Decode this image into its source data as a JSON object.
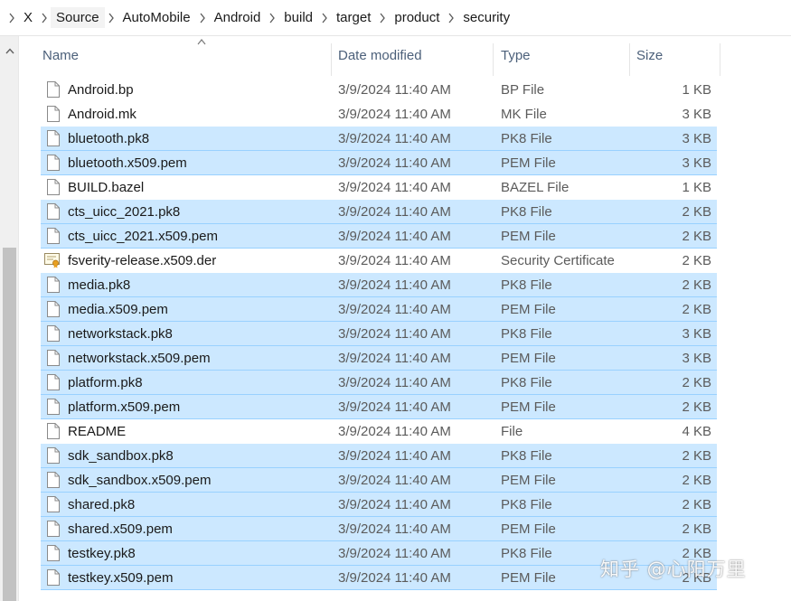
{
  "breadcrumb": {
    "root": "X",
    "items": [
      "Source",
      "AutoMobile",
      "Android",
      "build",
      "target",
      "product",
      "security"
    ]
  },
  "columns": {
    "name": "Name",
    "date": "Date modified",
    "type": "Type",
    "size": "Size"
  },
  "files": [
    {
      "name": "Android.bp",
      "date": "3/9/2024 11:40 AM",
      "type": "BP File",
      "size": "1 KB",
      "selected": false,
      "icon": "file-icon"
    },
    {
      "name": "Android.mk",
      "date": "3/9/2024 11:40 AM",
      "type": "MK File",
      "size": "3 KB",
      "selected": false,
      "icon": "file-icon"
    },
    {
      "name": "bluetooth.pk8",
      "date": "3/9/2024 11:40 AM",
      "type": "PK8 File",
      "size": "3 KB",
      "selected": true,
      "icon": "file-icon"
    },
    {
      "name": "bluetooth.x509.pem",
      "date": "3/9/2024 11:40 AM",
      "type": "PEM File",
      "size": "3 KB",
      "selected": true,
      "icon": "file-icon"
    },
    {
      "name": "BUILD.bazel",
      "date": "3/9/2024 11:40 AM",
      "type": "BAZEL File",
      "size": "1 KB",
      "selected": false,
      "icon": "file-icon"
    },
    {
      "name": "cts_uicc_2021.pk8",
      "date": "3/9/2024 11:40 AM",
      "type": "PK8 File",
      "size": "2 KB",
      "selected": true,
      "icon": "file-icon"
    },
    {
      "name": "cts_uicc_2021.x509.pem",
      "date": "3/9/2024 11:40 AM",
      "type": "PEM File",
      "size": "2 KB",
      "selected": true,
      "icon": "file-icon"
    },
    {
      "name": "fsverity-release.x509.der",
      "date": "3/9/2024 11:40 AM",
      "type": "Security Certificate",
      "size": "2 KB",
      "selected": false,
      "icon": "certificate-icon"
    },
    {
      "name": "media.pk8",
      "date": "3/9/2024 11:40 AM",
      "type": "PK8 File",
      "size": "2 KB",
      "selected": true,
      "icon": "file-icon"
    },
    {
      "name": "media.x509.pem",
      "date": "3/9/2024 11:40 AM",
      "type": "PEM File",
      "size": "2 KB",
      "selected": true,
      "icon": "file-icon"
    },
    {
      "name": "networkstack.pk8",
      "date": "3/9/2024 11:40 AM",
      "type": "PK8 File",
      "size": "3 KB",
      "selected": true,
      "icon": "file-icon"
    },
    {
      "name": "networkstack.x509.pem",
      "date": "3/9/2024 11:40 AM",
      "type": "PEM File",
      "size": "3 KB",
      "selected": true,
      "icon": "file-icon"
    },
    {
      "name": "platform.pk8",
      "date": "3/9/2024 11:40 AM",
      "type": "PK8 File",
      "size": "2 KB",
      "selected": true,
      "icon": "file-icon"
    },
    {
      "name": "platform.x509.pem",
      "date": "3/9/2024 11:40 AM",
      "type": "PEM File",
      "size": "2 KB",
      "selected": true,
      "icon": "file-icon"
    },
    {
      "name": "README",
      "date": "3/9/2024 11:40 AM",
      "type": "File",
      "size": "4 KB",
      "selected": false,
      "icon": "file-icon"
    },
    {
      "name": "sdk_sandbox.pk8",
      "date": "3/9/2024 11:40 AM",
      "type": "PK8 File",
      "size": "2 KB",
      "selected": true,
      "icon": "file-icon"
    },
    {
      "name": "sdk_sandbox.x509.pem",
      "date": "3/9/2024 11:40 AM",
      "type": "PEM File",
      "size": "2 KB",
      "selected": true,
      "icon": "file-icon"
    },
    {
      "name": "shared.pk8",
      "date": "3/9/2024 11:40 AM",
      "type": "PK8 File",
      "size": "2 KB",
      "selected": true,
      "icon": "file-icon"
    },
    {
      "name": "shared.x509.pem",
      "date": "3/9/2024 11:40 AM",
      "type": "PEM File",
      "size": "2 KB",
      "selected": true,
      "icon": "file-icon"
    },
    {
      "name": "testkey.pk8",
      "date": "3/9/2024 11:40 AM",
      "type": "PK8 File",
      "size": "2 KB",
      "selected": true,
      "icon": "file-icon"
    },
    {
      "name": "testkey.x509.pem",
      "date": "3/9/2024 11:40 AM",
      "type": "PEM File",
      "size": "2 KB",
      "selected": true,
      "icon": "file-icon"
    }
  ],
  "watermark": "知乎 @心阳万里",
  "colors": {
    "selection_fill": "#cce8ff",
    "selection_border": "#99d1ff",
    "header_text": "#4c607a",
    "scroll_thumb": "#c2c2c2"
  }
}
